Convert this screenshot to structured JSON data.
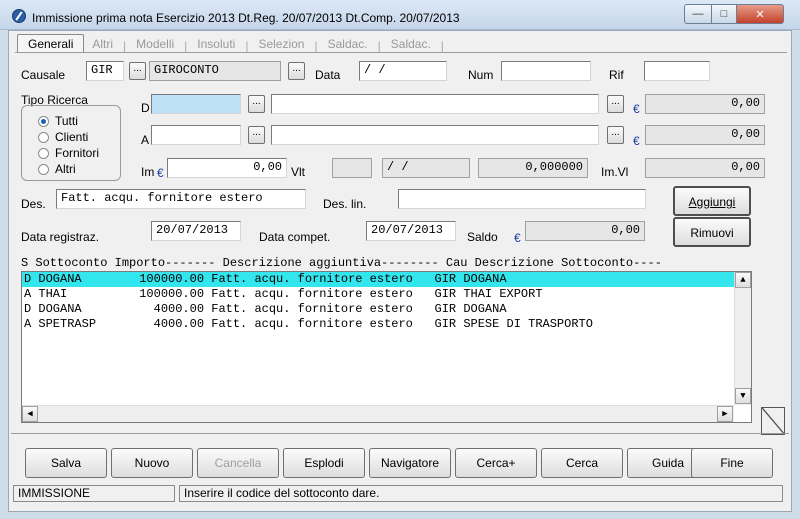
{
  "window": {
    "title": "Immissione prima nota  Esercizio 2013  Dt.Reg. 20/07/2013  Dt.Comp. 20/07/2013"
  },
  "tabs": [
    {
      "label": "Generali",
      "active": true
    },
    {
      "label": "Altri"
    },
    {
      "label": "Modelli"
    },
    {
      "label": "Insoluti"
    },
    {
      "label": "Selezion"
    },
    {
      "label": "Saldac."
    },
    {
      "label": "Saldac."
    }
  ],
  "form": {
    "causale_label": "Causale",
    "causale_code": "GIR",
    "causale_desc": "GIROCONTO",
    "data_label": "Data",
    "data_value": "  /  /",
    "num_label": "Num",
    "num_value": "",
    "rif_label": "Rif",
    "rif_value": "",
    "tipo_ricerca_label": "Tipo Ricerca",
    "radio_options": [
      "Tutti",
      "Clienti",
      "Fornitori",
      "Altri"
    ],
    "radio_selected": "Tutti",
    "d_label": "D",
    "a_label": "A",
    "d_amount": "0,00",
    "a_amount": "0,00",
    "im_label": "Im",
    "im_value": "0,00",
    "vlt_label": "Vlt",
    "date_ro": "  /  /",
    "rate": "0,000000",
    "imvl_label": "Im.Vl",
    "imvl_value": "0,00",
    "des_label": "Des.",
    "des_value": "Fatt. acqu. fornitore estero",
    "deslin_label": "Des. lin.",
    "deslin_value": "",
    "data_registraz_label": "Data registraz.",
    "data_registraz_value": "20/07/2013",
    "data_compet_label": "Data compet.",
    "data_compet_value": "20/07/2013",
    "saldo_label": "Saldo",
    "saldo_value": "0,00",
    "currency_symbol": "€",
    "dots": "..."
  },
  "side_buttons": {
    "aggiungi": "Aggiungi",
    "rimuovi": "Rimuovi"
  },
  "list": {
    "header": "S Sottoconto Importo------- Descrizione aggiuntiva-------- Cau Descrizione Sottoconto----",
    "rows": [
      {
        "s": "D",
        "sottoconto": "DOGANA",
        "importo": "100000.00",
        "descrizione": "Fatt. acqu. fornitore estero",
        "cau": "GIR",
        "desc_sottoconto": "DOGANA",
        "selected": true
      },
      {
        "s": "A",
        "sottoconto": "THAI",
        "importo": "100000.00",
        "descrizione": "Fatt. acqu. fornitore estero",
        "cau": "GIR",
        "desc_sottoconto": "THAI EXPORT"
      },
      {
        "s": "D",
        "sottoconto": "DOGANA",
        "importo": "4000.00",
        "descrizione": "Fatt. acqu. fornitore estero",
        "cau": "GIR",
        "desc_sottoconto": "DOGANA"
      },
      {
        "s": "A",
        "sottoconto": "SPETRASP",
        "importo": "4000.00",
        "descrizione": "Fatt. acqu. fornitore estero",
        "cau": "GIR",
        "desc_sottoconto": "SPESE DI TRASPORTO"
      }
    ]
  },
  "bottom_buttons": [
    {
      "label": "Salva"
    },
    {
      "label": "Nuovo"
    },
    {
      "label": "Cancella",
      "disabled": true
    },
    {
      "label": "Esplodi"
    },
    {
      "label": "Navigatore"
    },
    {
      "label": "Cerca+"
    },
    {
      "label": "Cerca"
    },
    {
      "label": "Guida"
    },
    {
      "label": "Fine"
    }
  ],
  "status": {
    "mode": "IMMISSIONE",
    "message": "Inserire il codice del sottoconto dare."
  }
}
